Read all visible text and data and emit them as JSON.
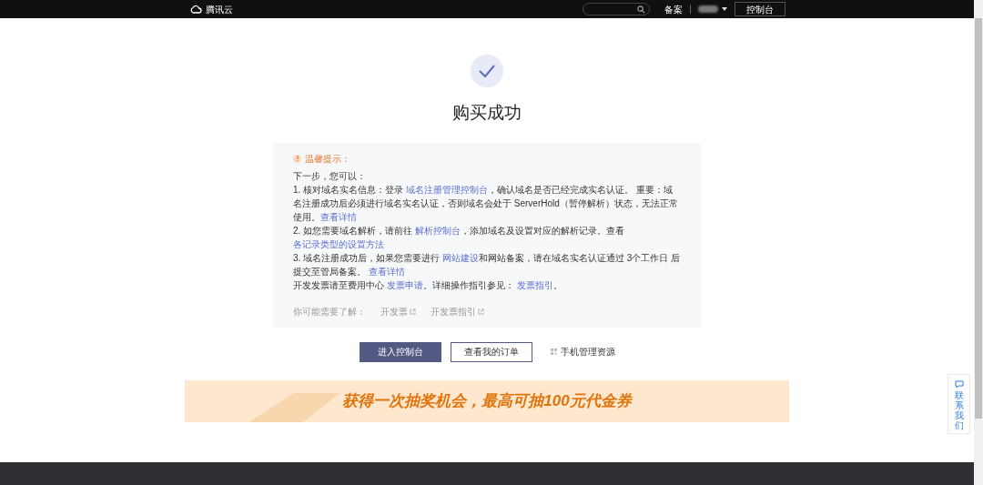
{
  "topbar": {
    "logo": "腾讯云",
    "links": [
      "备案"
    ],
    "console_button": "控制台"
  },
  "title": "购买成功",
  "notice": {
    "heading": "温馨提示：",
    "paragraphs": [
      {
        "parts": [
          {
            "text": "下一步，您可以：",
            "link": false
          }
        ]
      },
      {
        "parts": [
          {
            "text": "1. 核对域名实名信息：登录 ",
            "link": false
          },
          {
            "text": "域名注册管理控制台",
            "link": true
          },
          {
            "text": "，确认域名是否已经完成实名认证。 重要：域名注册成功后必须进行域名实名认证，否则域名会处于 ServerHold（暂停解析）状态，无法正常使用。",
            "link": false
          },
          {
            "text": "查看详情",
            "link": true
          }
        ]
      },
      {
        "parts": [
          {
            "text": "2. 如您需要域名解析，请前往 ",
            "link": false
          },
          {
            "text": "解析控制台",
            "link": true
          },
          {
            "text": "，添加域名及设置对应的解析记录。查看",
            "link": false
          },
          {
            "text": "各记录类型的设置方法",
            "link": true
          }
        ]
      },
      {
        "parts": [
          {
            "text": "3. 域名注册成功后，如果您需要进行 ",
            "link": false
          },
          {
            "text": "网站建设",
            "link": true
          },
          {
            "text": "和网站备案，请在域名实名认证通过 3个工作日 后提交至管局备案。 ",
            "link": false
          },
          {
            "text": "查看详情",
            "link": true
          }
        ]
      },
      {
        "parts": [
          {
            "text": "开发发票请至费用中心 ",
            "link": false
          },
          {
            "text": "发票申请",
            "link": true
          },
          {
            "text": "。详细操作指引参见： ",
            "link": false
          },
          {
            "text": "发票指引",
            "link": true
          },
          {
            "text": "。",
            "link": false
          }
        ]
      }
    ],
    "related_label": "你可能需要了解：",
    "related_links": [
      "开发票",
      "开发票指引"
    ]
  },
  "actions": {
    "primary": "进入控制台",
    "secondary": "查看我的订单",
    "mobile": "手机管理资源"
  },
  "banner": "获得一次抽奖机会，最高可抽100元代金券",
  "contact": "联系我们"
}
